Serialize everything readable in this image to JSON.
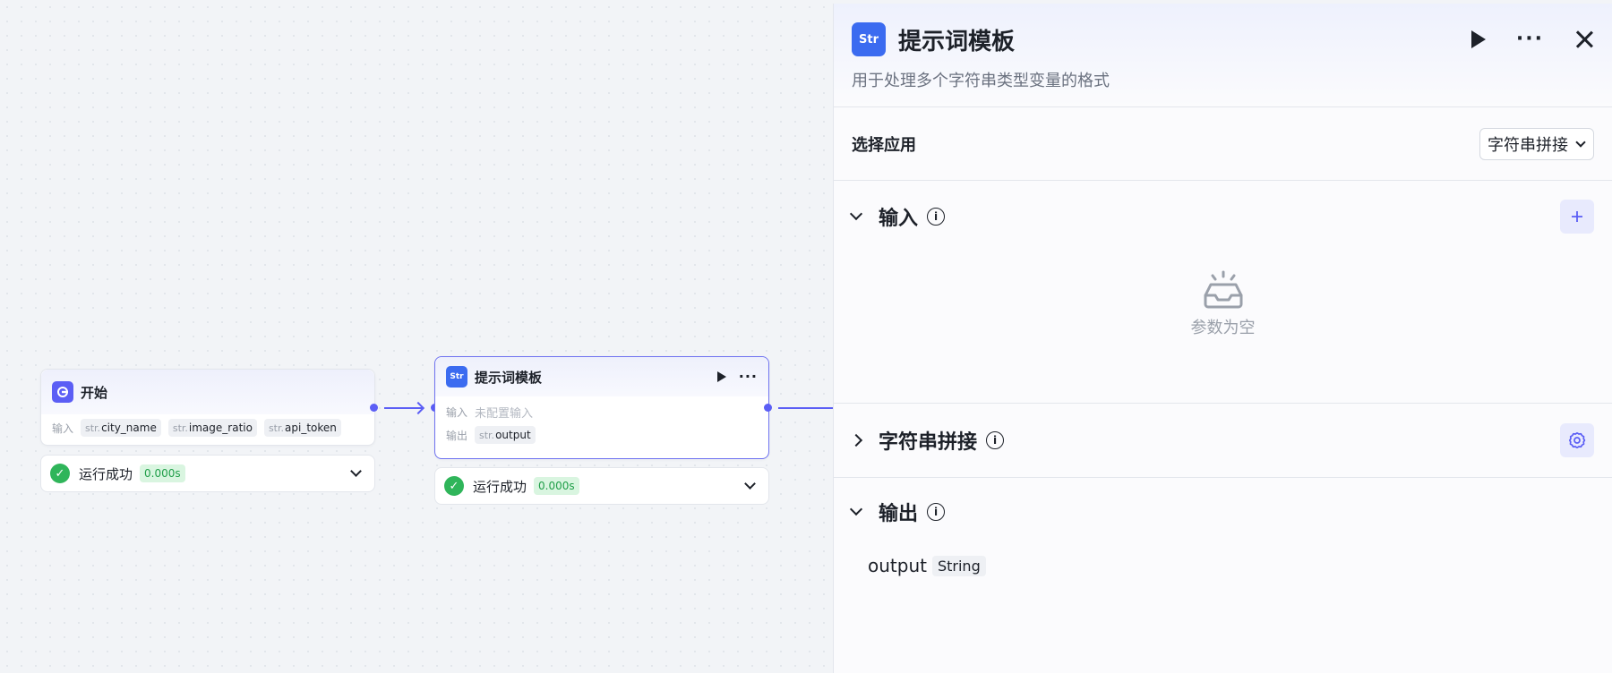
{
  "canvas": {
    "start_node": {
      "title": "开始",
      "input_label": "输入",
      "inputs": [
        {
          "prefix": "str.",
          "name": "city_name"
        },
        {
          "prefix": "str.",
          "name": "image_ratio"
        },
        {
          "prefix": "str.",
          "name": "api_token"
        }
      ],
      "status": "运行成功",
      "time": "0.000s"
    },
    "template_node": {
      "title": "提示词模板",
      "input_label": "输入",
      "input_placeholder": "未配置输入",
      "output_label": "输出",
      "output": {
        "prefix": "str.",
        "name": "output"
      },
      "status": "运行成功",
      "time": "0.000s"
    }
  },
  "panel": {
    "icon_text": "Str",
    "title": "提示词模板",
    "description": "用于处理多个字符串类型变量的格式",
    "select_label": "选择应用",
    "select_value": "字符串拼接",
    "input_section": {
      "title": "输入",
      "empty_text": "参数为空"
    },
    "concat_section": {
      "title": "字符串拼接"
    },
    "output_section": {
      "title": "输出",
      "output_name": "output",
      "output_type": "String"
    }
  },
  "icons": {
    "node_start": "start-icon",
    "node_str": "str-icon",
    "empty": "inbox-icon",
    "settings": "gear-icon",
    "add": "plus-icon"
  },
  "colors": {
    "accent": "#5b5ef5",
    "success": "#2fb55a",
    "str_icon": "#3b6bf0"
  }
}
